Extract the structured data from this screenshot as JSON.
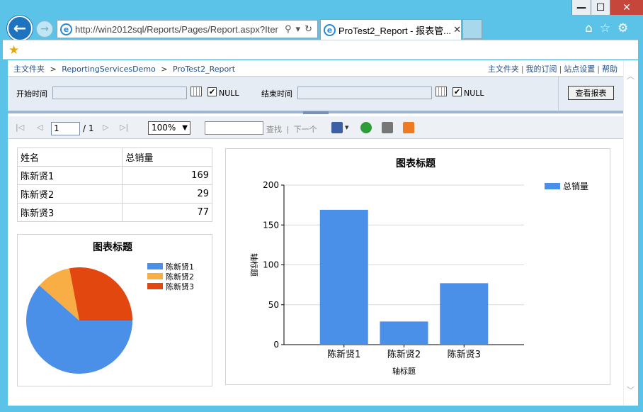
{
  "window": {
    "minimize_glyph": "—",
    "maximize_glyph": "☐",
    "close_glyph": "✕"
  },
  "browser": {
    "address": "http://win2012sql/Reports/Pages/Report.aspx?Iter",
    "address_host": "win2012sql",
    "tab_title": "ProTest2_Report - 报表管...",
    "icons": [
      "back-arrow-icon",
      "forward-arrow-icon",
      "ie-logo-icon",
      "search-icon",
      "dropdown-icon",
      "refresh-icon",
      "tab-close-icon",
      "home-icon",
      "favorites-star-icon",
      "settings-gear-icon",
      "add-favorites-icon"
    ]
  },
  "breadcrumb": {
    "home": "主文件夹",
    "sep": ">",
    "folder": "ReportingServicesDemo",
    "report": "ProTest2_Report"
  },
  "topnav": {
    "items": [
      "主文件夹",
      "我的订阅",
      "站点设置",
      "帮助"
    ],
    "sep": "|"
  },
  "params": {
    "start_label": "开始时间",
    "start_value": "",
    "start_null_checked": true,
    "end_label": "结束时间",
    "end_value": "",
    "end_null_checked": true,
    "null_label": "NULL",
    "view_button": "查看报表",
    "check_glyph": "✔"
  },
  "toolbar": {
    "page_current": "1",
    "page_total": "/ 1",
    "zoom": "100%",
    "find_value": "",
    "find_label": "查找",
    "find_sep": "|",
    "next_label": "下一个"
  },
  "table": {
    "headers": [
      "姓名",
      "总销量"
    ],
    "rows": [
      {
        "name": "陈新贤1",
        "value": "169"
      },
      {
        "name": "陈新贤2",
        "value": "29"
      },
      {
        "name": "陈新贤3",
        "value": "77"
      }
    ]
  },
  "chart_data": [
    {
      "type": "pie",
      "title": "图表标题",
      "categories": [
        "陈新贤1",
        "陈新贤2",
        "陈新贤3"
      ],
      "values": [
        169,
        29,
        77
      ],
      "colors": [
        "#4a8fe8",
        "#f9ae45",
        "#e1470e"
      ],
      "legend": "right"
    },
    {
      "type": "bar",
      "title": "图表标题",
      "categories": [
        "陈新贤1",
        "陈新贤2",
        "陈新贤3"
      ],
      "series": [
        {
          "name": "总销量",
          "values": [
            169,
            29,
            77
          ]
        }
      ],
      "xlabel": "轴标题",
      "ylabel": "轴标题",
      "ylim": [
        0,
        200
      ],
      "yticks": [
        0,
        50,
        100,
        150,
        200
      ],
      "grid": true,
      "legend": "top-right",
      "color": "#4a8fe8"
    }
  ]
}
